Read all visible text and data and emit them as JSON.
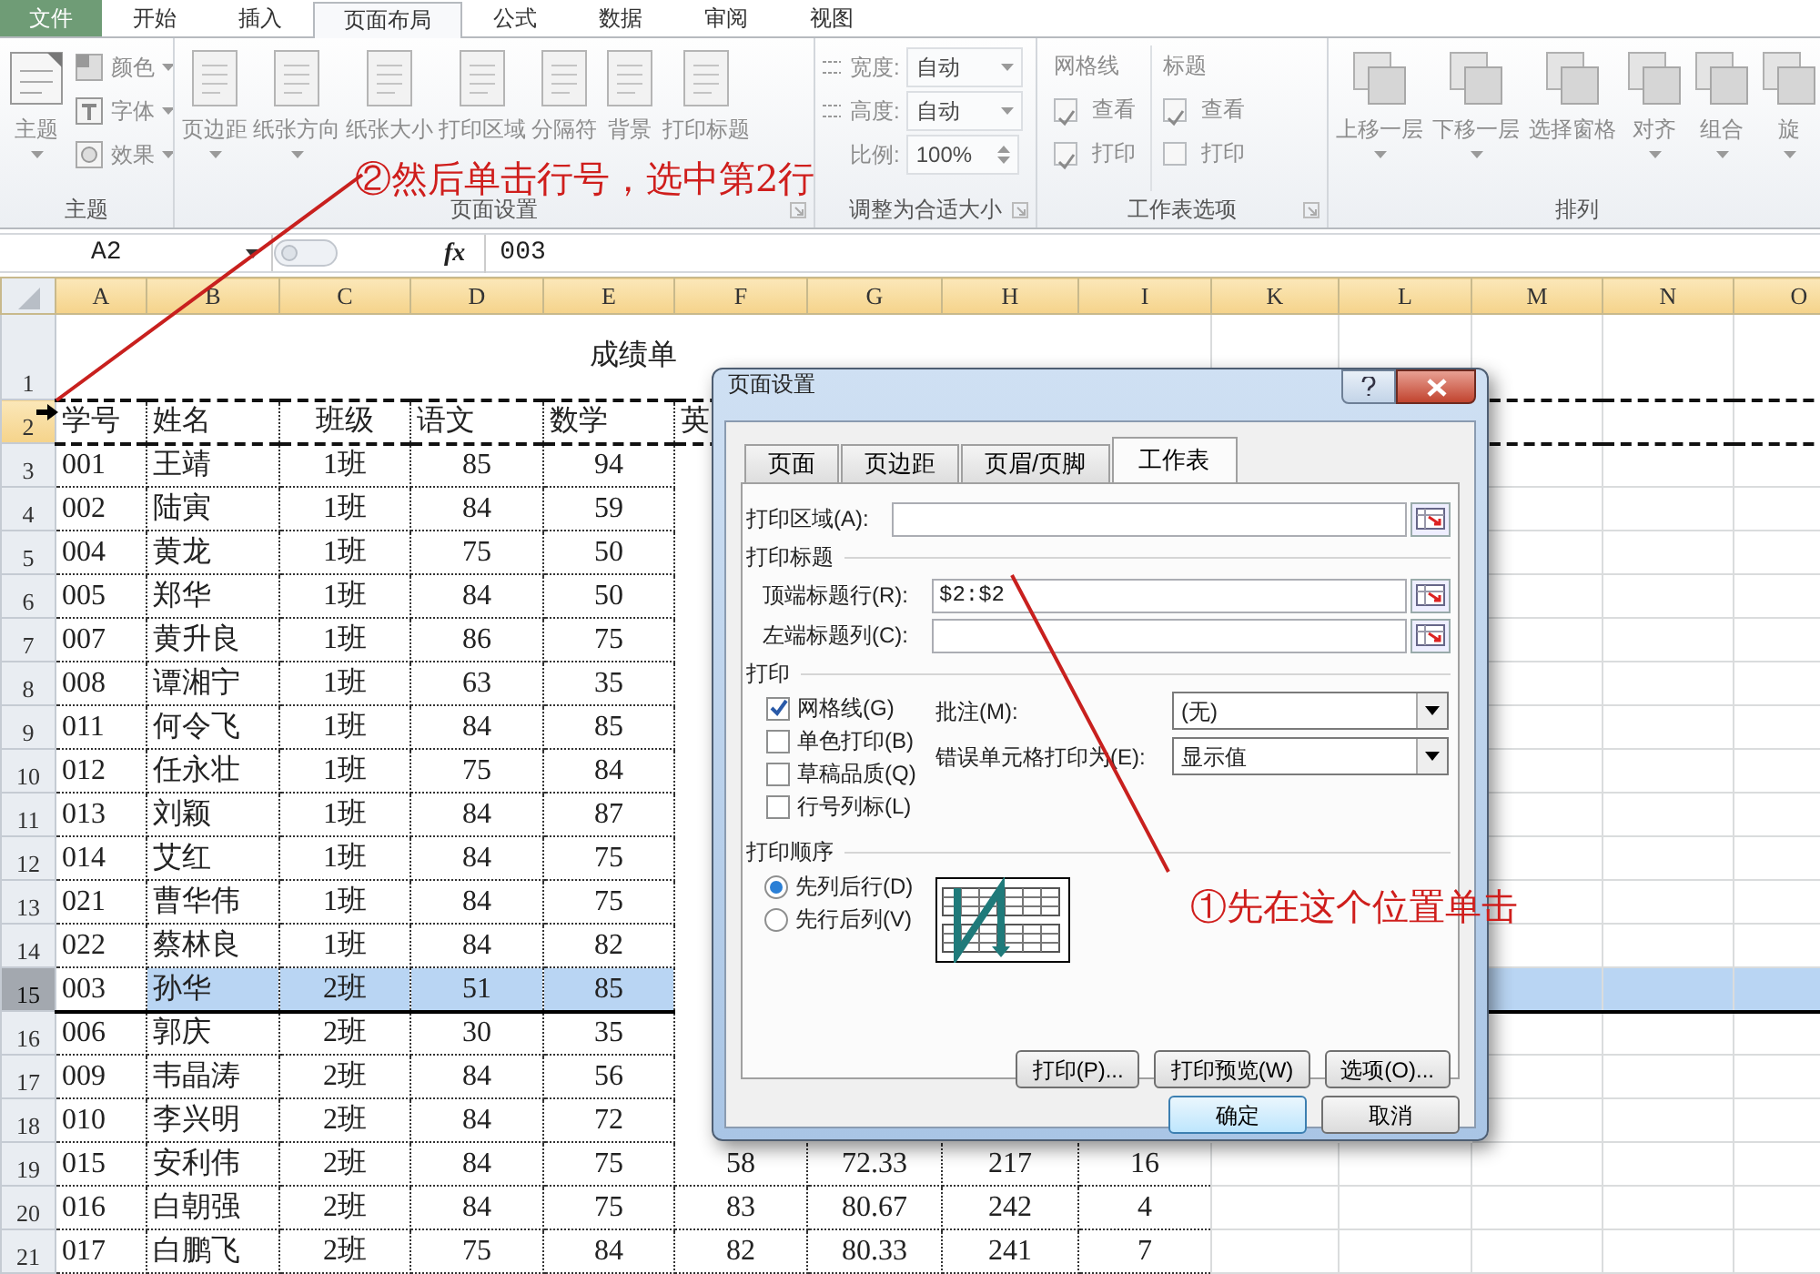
{
  "ribbon": {
    "tabs": [
      {
        "label": "文件",
        "kind": "file",
        "selected": false
      },
      {
        "label": "开始",
        "kind": "tab",
        "selected": false
      },
      {
        "label": "插入",
        "kind": "tab",
        "selected": false
      },
      {
        "label": "页面布局",
        "kind": "tab",
        "selected": true
      },
      {
        "label": "公式",
        "kind": "tab",
        "selected": false
      },
      {
        "label": "数据",
        "kind": "tab",
        "selected": false
      },
      {
        "label": "审阅",
        "kind": "tab",
        "selected": false
      },
      {
        "label": "视图",
        "kind": "tab",
        "selected": false
      }
    ],
    "groups": [
      {
        "kind": "theme",
        "label": "主题",
        "launcher": false,
        "buttons": [
          {
            "label": "主题",
            "dropdown": true
          }
        ],
        "small": [
          {
            "label": "颜色"
          },
          {
            "label": "字体"
          },
          {
            "label": "效果"
          }
        ]
      },
      {
        "kind": "buttons",
        "label": "页面设置",
        "launcher": true,
        "buttons": [
          {
            "label": "页边距",
            "dropdown": true
          },
          {
            "label": "纸张方向",
            "dropdown": true
          },
          {
            "label": "纸张大小",
            "dropdown": false
          },
          {
            "label": "打印区域",
            "dropdown": false
          },
          {
            "label": "分隔符",
            "dropdown": false
          },
          {
            "label": "背景",
            "dropdown": false
          },
          {
            "label": "打印标题",
            "dropdown": false
          }
        ]
      },
      {
        "kind": "scale",
        "label": "调整为合适大小",
        "launcher": true,
        "fields": [
          {
            "label": "宽度:",
            "value": "自动",
            "kind": "select"
          },
          {
            "label": "高度:",
            "value": "自动",
            "kind": "select"
          },
          {
            "label": "比例:",
            "value": "100%",
            "kind": "spin"
          }
        ]
      },
      {
        "kind": "options",
        "label": "工作表选项",
        "launcher": true,
        "columns": [
          {
            "title": "网格线",
            "options": [
              {
                "label": "查看",
                "checked": true
              },
              {
                "label": "打印",
                "checked": true
              }
            ]
          },
          {
            "title": "标题",
            "options": [
              {
                "label": "查看",
                "checked": true
              },
              {
                "label": "打印",
                "checked": false
              }
            ]
          }
        ]
      },
      {
        "kind": "buttons",
        "label": "排列",
        "launcher": false,
        "buttons": [
          {
            "label": "上移一层",
            "dropdown": true
          },
          {
            "label": "下移一层",
            "dropdown": true
          },
          {
            "label": "选择窗格",
            "dropdown": false
          },
          {
            "label": "对齐",
            "dropdown": true
          },
          {
            "label": "组合",
            "dropdown": true
          },
          {
            "label": "旋",
            "dropdown": true
          }
        ]
      }
    ]
  },
  "formula_bar": {
    "name_box": "A2",
    "fx": "fx",
    "formula": "003"
  },
  "sheet": {
    "columns": [
      "A",
      "B",
      "C",
      "D",
      "E",
      "F",
      "G",
      "H",
      "I",
      "K",
      "L",
      "M",
      "N",
      "O"
    ],
    "title_row": {
      "header": "1",
      "title": "成绩单"
    },
    "rows": [
      {
        "header": "2",
        "kind": "header",
        "active": true,
        "selected": false,
        "cells": [
          "学号",
          "姓名",
          "班级",
          "语文",
          "数学",
          "英"
        ]
      },
      {
        "header": "3",
        "kind": "data",
        "active": false,
        "selected": false,
        "cells": [
          "001",
          "王靖",
          "1班",
          "85",
          "94"
        ]
      },
      {
        "header": "4",
        "kind": "data",
        "active": false,
        "selected": false,
        "cells": [
          "002",
          "陆寅",
          "1班",
          "84",
          "59"
        ]
      },
      {
        "header": "5",
        "kind": "data",
        "active": false,
        "selected": false,
        "cells": [
          "004",
          "黄龙",
          "1班",
          "75",
          "50"
        ]
      },
      {
        "header": "6",
        "kind": "data",
        "active": false,
        "selected": false,
        "cells": [
          "005",
          "郑华",
          "1班",
          "84",
          "50"
        ]
      },
      {
        "header": "7",
        "kind": "data",
        "active": false,
        "selected": false,
        "cells": [
          "007",
          "黄升良",
          "1班",
          "86",
          "75"
        ]
      },
      {
        "header": "8",
        "kind": "data",
        "active": false,
        "selected": false,
        "cells": [
          "008",
          "谭湘宁",
          "1班",
          "63",
          "35"
        ]
      },
      {
        "header": "9",
        "kind": "data",
        "active": false,
        "selected": false,
        "cells": [
          "011",
          "何令飞",
          "1班",
          "84",
          "85"
        ]
      },
      {
        "header": "10",
        "kind": "data",
        "active": false,
        "selected": false,
        "cells": [
          "012",
          "任永壮",
          "1班",
          "75",
          "84"
        ]
      },
      {
        "header": "11",
        "kind": "data",
        "active": false,
        "selected": false,
        "cells": [
          "013",
          "刘颖",
          "1班",
          "84",
          "87"
        ]
      },
      {
        "header": "12",
        "kind": "data",
        "active": false,
        "selected": false,
        "cells": [
          "014",
          "艾红",
          "1班",
          "84",
          "75"
        ]
      },
      {
        "header": "13",
        "kind": "data",
        "active": false,
        "selected": false,
        "cells": [
          "021",
          "曹华伟",
          "1班",
          "84",
          "75"
        ]
      },
      {
        "header": "14",
        "kind": "data",
        "active": false,
        "selected": false,
        "cells": [
          "022",
          "蔡林良",
          "1班",
          "84",
          "82"
        ]
      },
      {
        "header": "15",
        "kind": "data",
        "active": false,
        "selected": true,
        "cells": [
          "003",
          "孙华",
          "2班",
          "51",
          "85"
        ]
      },
      {
        "header": "16",
        "kind": "data",
        "active": false,
        "selected": false,
        "cells": [
          "006",
          "郭庆",
          "2班",
          "30",
          "35"
        ]
      },
      {
        "header": "17",
        "kind": "data",
        "active": false,
        "selected": false,
        "cells": [
          "009",
          "韦晶涛",
          "2班",
          "84",
          "56"
        ]
      },
      {
        "header": "18",
        "kind": "data",
        "active": false,
        "selected": false,
        "cells": [
          "010",
          "李兴明",
          "2班",
          "84",
          "72"
        ]
      },
      {
        "header": "19",
        "kind": "data",
        "active": false,
        "selected": false,
        "cells": [
          "015",
          "安利伟",
          "2班",
          "84",
          "75",
          "58",
          "72.33",
          "217",
          "16"
        ]
      },
      {
        "header": "20",
        "kind": "data",
        "active": false,
        "selected": false,
        "cells": [
          "016",
          "白朝强",
          "2班",
          "84",
          "75",
          "83",
          "80.67",
          "242",
          "4"
        ]
      },
      {
        "header": "21",
        "kind": "data",
        "active": false,
        "selected": false,
        "cells": [
          "017",
          "白鹏飞",
          "2班",
          "75",
          "84",
          "82",
          "80.33",
          "241",
          "7"
        ]
      }
    ]
  },
  "dialog": {
    "title": "页面设置",
    "tabs": [
      {
        "label": "页面",
        "selected": false
      },
      {
        "label": "页边距",
        "selected": false
      },
      {
        "label": "页眉/页脚",
        "selected": false
      },
      {
        "label": "工作表",
        "selected": true
      }
    ],
    "print_area": {
      "label": "打印区域(A):"
    },
    "print_titles": {
      "title": "打印标题",
      "fields": [
        {
          "label": "顶端标题行(R):",
          "value": "$2:$2"
        },
        {
          "label": "左端标题列(C):"
        }
      ]
    },
    "print": {
      "title": "打印",
      "options": [
        {
          "label": "网格线(G)",
          "checked": true
        },
        {
          "label": "单色打印(B)",
          "checked": false
        },
        {
          "label": "草稿品质(Q)",
          "checked": false
        },
        {
          "label": "行号列标(L)",
          "checked": false
        }
      ],
      "selects": [
        {
          "label": "批注(M):",
          "value": "(无)"
        },
        {
          "label": "错误单元格打印为(E):",
          "value": "显示值"
        }
      ]
    },
    "order": {
      "title": "打印顺序",
      "options": [
        {
          "label": "先列后行(D)",
          "selected": true
        },
        {
          "label": "先行后列(V)",
          "selected": false
        }
      ]
    },
    "buttons": [
      {
        "label": "打印(P)..."
      },
      {
        "label": "打印预览(W)"
      },
      {
        "label": "选项(O)..."
      }
    ],
    "footer_buttons": [
      {
        "label": "确定",
        "default": true
      },
      {
        "label": "取消",
        "default": false
      }
    ]
  },
  "annotations": [
    {
      "text": "②然后单击行号，选中第2行"
    },
    {
      "text": "①先在这个位置单击"
    }
  ]
}
